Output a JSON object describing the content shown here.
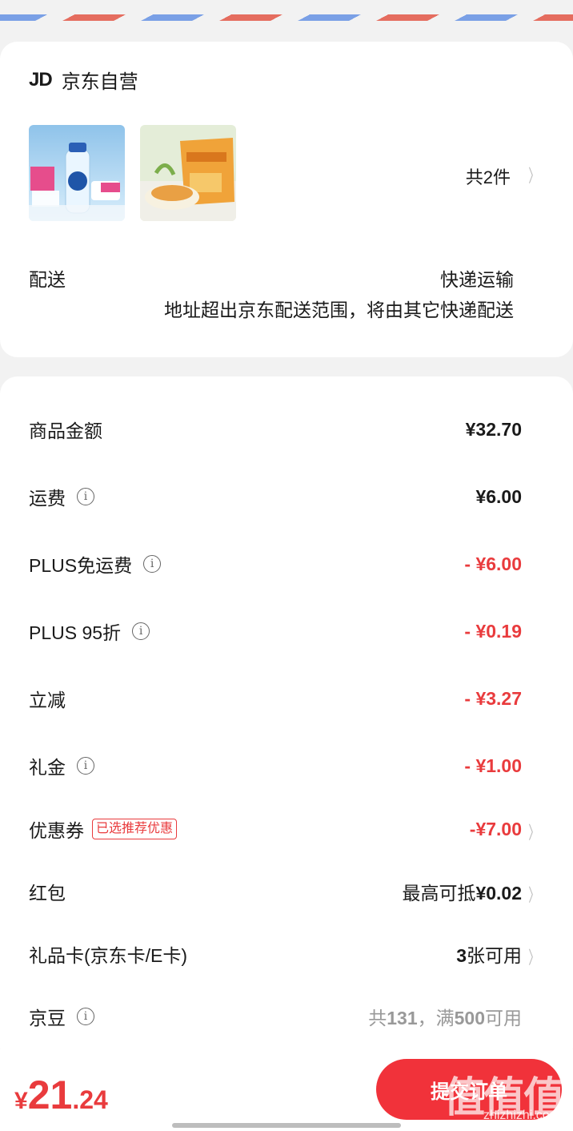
{
  "shop": {
    "logo": "JD",
    "name": "京东自营",
    "item_count": "共2件",
    "delivery_label": "配送",
    "delivery_method": "快递运输",
    "delivery_note": "地址超出京东配送范围，将由其它快递配送"
  },
  "fees": {
    "goods_amount_label": "商品金额",
    "goods_amount_value": "¥32.70",
    "shipping_label": "运费",
    "shipping_value": "¥6.00",
    "plus_free_shipping_label": "PLUS免运费",
    "plus_free_shipping_value": "- ¥6.00",
    "plus_discount_label": "PLUS 95折",
    "plus_discount_value": "- ¥0.19",
    "instant_discount_label": "立减",
    "instant_discount_value": "- ¥3.27",
    "gift_money_label": "礼金",
    "gift_money_value": "- ¥1.00",
    "coupon_label": "优惠券",
    "coupon_badge": "已选推荐优惠",
    "coupon_value": "-¥7.00",
    "red_packet_label": "红包",
    "red_packet_prefix": "最高可抵",
    "red_packet_amount": "¥0.02",
    "gift_card_label": "礼品卡(京东卡/E卡)",
    "gift_card_count": "3",
    "gift_card_suffix": "张可用",
    "jd_beans_label": "京豆",
    "jd_beans_prefix": "共",
    "jd_beans_total": "131",
    "jd_beans_mid": "，满",
    "jd_beans_min": "500",
    "jd_beans_suffix": "可用"
  },
  "bottom": {
    "currency": "¥",
    "total_int": "21",
    "total_dec": ".24",
    "submit_label": "提交订单",
    "watermark": "值值值",
    "watermark_url": "zhizhizhi.com"
  },
  "colors": {
    "accent_red": "#e93b3d",
    "button_red": "#f1323a"
  }
}
